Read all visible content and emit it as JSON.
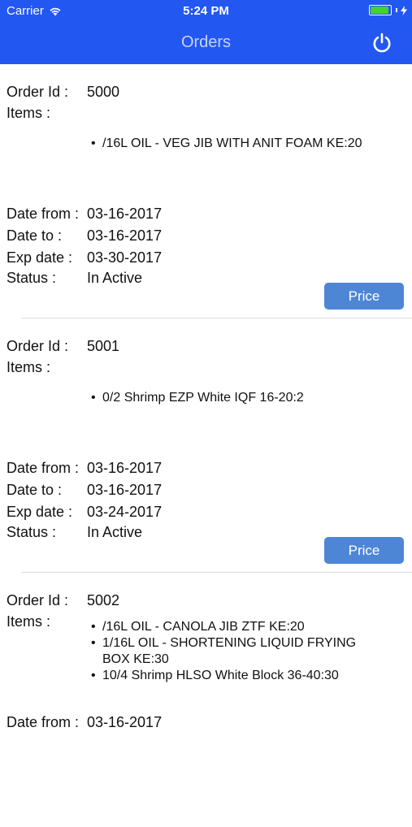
{
  "status_bar": {
    "carrier": "Carrier",
    "time": "5:24 PM",
    "battery_level": 0.9,
    "battery_color": "#44d32f"
  },
  "navbar": {
    "title": "Orders",
    "background": "#2257f2"
  },
  "labels": {
    "order_id": "Order Id :",
    "items": "Items :",
    "date_from": "Date from :",
    "date_to": "Date to :",
    "exp_date": "Exp date :",
    "status": "Status :",
    "price_button": "Price"
  },
  "orders": [
    {
      "order_id": "5000",
      "items": [
        "/16L OIL - VEG JIB WITH ANIT FOAM KE:20"
      ],
      "date_from": "03-16-2017",
      "date_to": "03-16-2017",
      "exp_date": "03-30-2017",
      "status": "In Active"
    },
    {
      "order_id": "5001",
      "items": [
        "0/2 Shrimp EZP White IQF 16-20:2"
      ],
      "date_from": "03-16-2017",
      "date_to": "03-16-2017",
      "exp_date": "03-24-2017",
      "status": "In Active"
    },
    {
      "order_id": "5002",
      "items": [
        "/16L OIL - CANOLA JIB ZTF KE:20",
        "1/16L OIL - SHORTENING LIQUID FRYING BOX KE:30",
        "10/4 Shrimp HLSO White Block 36-40:30"
      ],
      "date_from": "03-16-2017"
    }
  ]
}
